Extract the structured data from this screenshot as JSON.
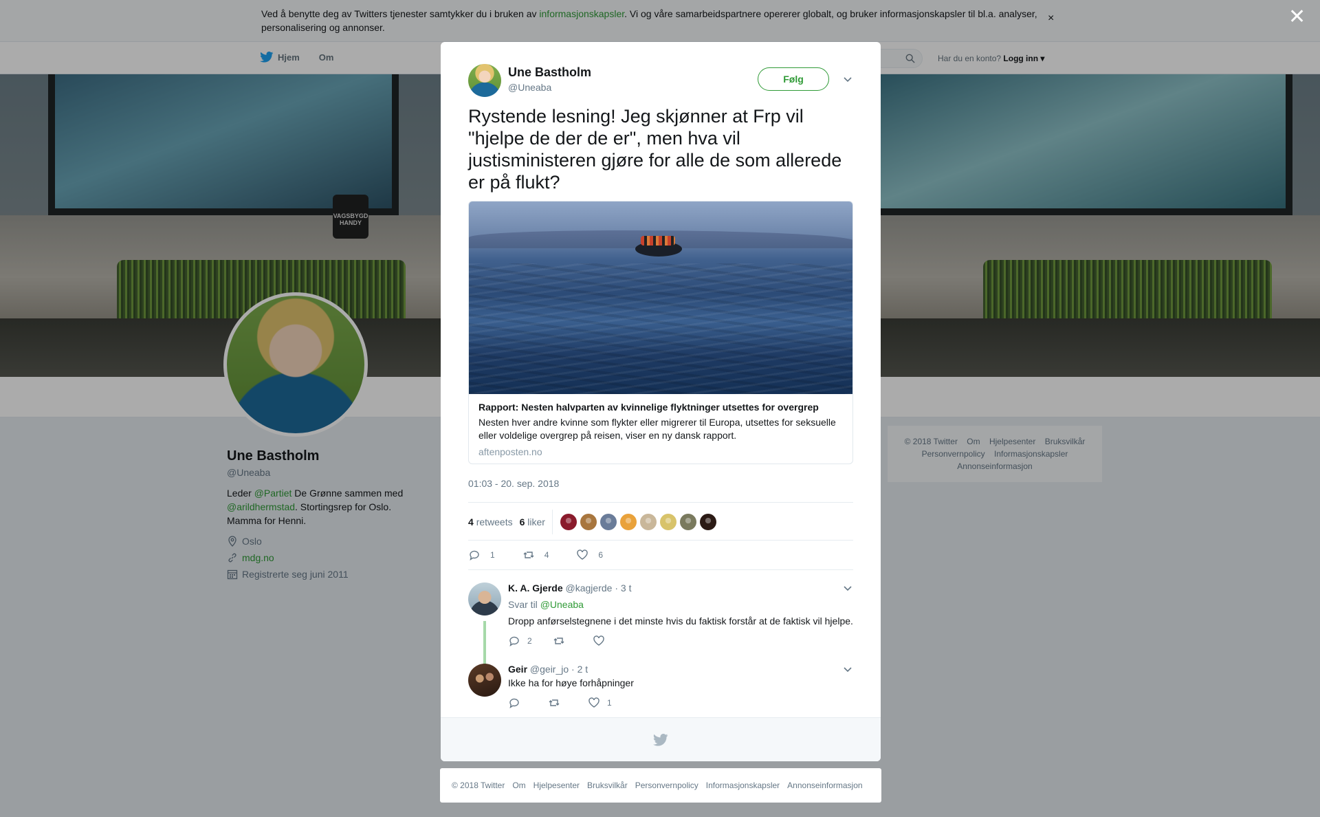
{
  "cookie_bar": {
    "text_before": "Ved å benytte deg av Twitters tjenester samtykker du i bruken av ",
    "link": "informasjonskapsler",
    "text_after": ". Vi og våre samarbeidspartnere opererer globalt, og bruker informasjonskapsler til bl.a. analyser, personalisering og annonser.",
    "close": "×"
  },
  "overlay_close": "✕",
  "topbar": {
    "home": "Hjem",
    "about": "Om",
    "login_prompt": "Har du en konto?",
    "login": "Logg inn"
  },
  "banner_sign": "VAGSBYGD HANDY",
  "profile": {
    "name": "Une Bastholm",
    "handle": "@Uneaba",
    "bio_1": "Leder ",
    "bio_link_1": "@Partiet",
    "bio_2": " De Grønne sammen med ",
    "bio_link_2": "@arildhermstad",
    "bio_3": ". Stortingsrep for Oslo. Mamma for Henni.",
    "location": "Oslo",
    "website": "mdg.no",
    "joined": "Registrerte seg juni 2011"
  },
  "right_footer": {
    "items": [
      "© 2018 Twitter",
      "Om",
      "Hjelpesenter",
      "Bruksvilkår",
      "Personvernpolicy",
      "Informasjonskapsler",
      "Annonseinformasjon"
    ]
  },
  "tweet": {
    "name": "Une Bastholm",
    "handle": "@Uneaba",
    "follow": "Følg",
    "text": "Rystende lesning! Jeg skjønner at Frp vil \"hjelpe de der de er\", men hva vil justisministeren gjøre for alle de som allerede er på flukt?",
    "card": {
      "title": "Rapport: Nesten halvparten av kvinnelige flyktninger utsettes for overgrep",
      "description": "Nesten hver andre kvinne som flykter eller migrerer til Europa, utsettes for seksuelle eller voldelige overgrep på reisen, viser en ny dansk rapport.",
      "domain": "aftenposten.no"
    },
    "time": "01:03 - 20. sep. 2018",
    "retweets_count": "4",
    "retweets_label": "retweets",
    "likes_count": "6",
    "likes_label": "liker",
    "face_colors": [
      "#8a1b2c",
      "#a8763e",
      "#6a7c99",
      "#e9a23b",
      "#c9b79a",
      "#d8c36a",
      "#7a7a5e",
      "#2b1a15"
    ],
    "actions": {
      "reply": "1",
      "retweet": "4",
      "like": "6"
    }
  },
  "replies": [
    {
      "name": "K. A. Gjerde",
      "handle": "@kagjerde",
      "sep": " · ",
      "time": "3 t",
      "reply_to_label": "Svar til ",
      "reply_to": "@Uneaba",
      "text": "Dropp anførselstegnene i det minste hvis du faktisk forstår at de faktisk vil hjelpe.",
      "reply_count": "2",
      "retweet_count": "",
      "like_count": ""
    },
    {
      "name": "Geir",
      "handle": "@geir_jo",
      "sep": " · ",
      "time": "2 t",
      "text": "Ikke ha for høye forhåpninger",
      "reply_count": "",
      "retweet_count": "",
      "like_count": "1"
    }
  ],
  "bottom_footer": {
    "items": [
      "© 2018 Twitter",
      "Om",
      "Hjelpesenter",
      "Bruksvilkår",
      "Personvernpolicy",
      "Informasjonskapsler",
      "Annonseinformasjon"
    ]
  },
  "colors": {
    "accent": "#2f9a36",
    "bird": "#1da1f2",
    "thread_line": "#a6d9a9"
  }
}
